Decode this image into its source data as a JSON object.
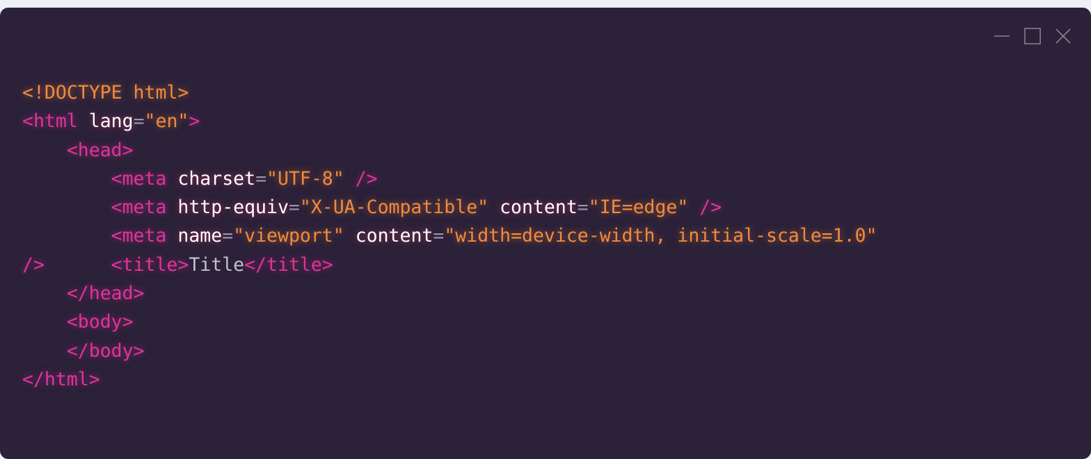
{
  "window": {
    "controls": [
      {
        "name": "minimize-icon"
      },
      {
        "name": "maximize-icon"
      },
      {
        "name": "close-icon"
      }
    ]
  },
  "colors": {
    "background": "#2b2139",
    "tag": "#e0339a",
    "string": "#f28a3c",
    "attribute": "#ffffff",
    "punctuation": "#9a93a8",
    "text": "#c4c0cc"
  },
  "code": {
    "lines": [
      [
        {
          "t": "doc",
          "v": "<!DOCTYPE html>"
        }
      ],
      [
        {
          "t": "tag",
          "v": "<html "
        },
        {
          "t": "attr",
          "v": "lang"
        },
        {
          "t": "eq",
          "v": "="
        },
        {
          "t": "str",
          "v": "\"en\""
        },
        {
          "t": "tag",
          "v": ">"
        }
      ],
      [
        {
          "t": "ws",
          "v": "    "
        },
        {
          "t": "tag",
          "v": "<head>"
        }
      ],
      [
        {
          "t": "ws",
          "v": "        "
        },
        {
          "t": "tag",
          "v": "<meta "
        },
        {
          "t": "attr",
          "v": "charset"
        },
        {
          "t": "eq",
          "v": "="
        },
        {
          "t": "str",
          "v": "\"UTF-8\""
        },
        {
          "t": "ws",
          "v": " "
        },
        {
          "t": "tag",
          "v": "/>"
        }
      ],
      [
        {
          "t": "ws",
          "v": "        "
        },
        {
          "t": "tag",
          "v": "<meta "
        },
        {
          "t": "attr",
          "v": "http-equiv"
        },
        {
          "t": "eq",
          "v": "="
        },
        {
          "t": "str",
          "v": "\"X-UA-Compatible\""
        },
        {
          "t": "ws",
          "v": " "
        },
        {
          "t": "attr",
          "v": "content"
        },
        {
          "t": "eq",
          "v": "="
        },
        {
          "t": "str",
          "v": "\"IE=edge\""
        },
        {
          "t": "ws",
          "v": " "
        },
        {
          "t": "tag",
          "v": "/>"
        }
      ],
      [
        {
          "t": "ws",
          "v": "        "
        },
        {
          "t": "tag",
          "v": "<meta "
        },
        {
          "t": "attr",
          "v": "name"
        },
        {
          "t": "eq",
          "v": "="
        },
        {
          "t": "str",
          "v": "\"viewport\""
        },
        {
          "t": "ws",
          "v": " "
        },
        {
          "t": "attr",
          "v": "content"
        },
        {
          "t": "eq",
          "v": "="
        },
        {
          "t": "str",
          "v": "\"width=device-width, initial-scale=1.0\""
        }
      ],
      [
        {
          "t": "tag",
          "v": "/>"
        },
        {
          "t": "ws",
          "v": "      "
        },
        {
          "t": "tag",
          "v": "<title>"
        },
        {
          "t": "text",
          "v": "Title"
        },
        {
          "t": "tag",
          "v": "</title>"
        }
      ],
      [
        {
          "t": "ws",
          "v": "    "
        },
        {
          "t": "tag",
          "v": "</head>"
        }
      ],
      [
        {
          "t": "ws",
          "v": "    "
        },
        {
          "t": "tag",
          "v": "<body>"
        }
      ],
      [
        {
          "t": "ws",
          "v": "    "
        },
        {
          "t": "tag",
          "v": "</body>"
        }
      ],
      [
        {
          "t": "tag",
          "v": "</html>"
        }
      ]
    ]
  }
}
